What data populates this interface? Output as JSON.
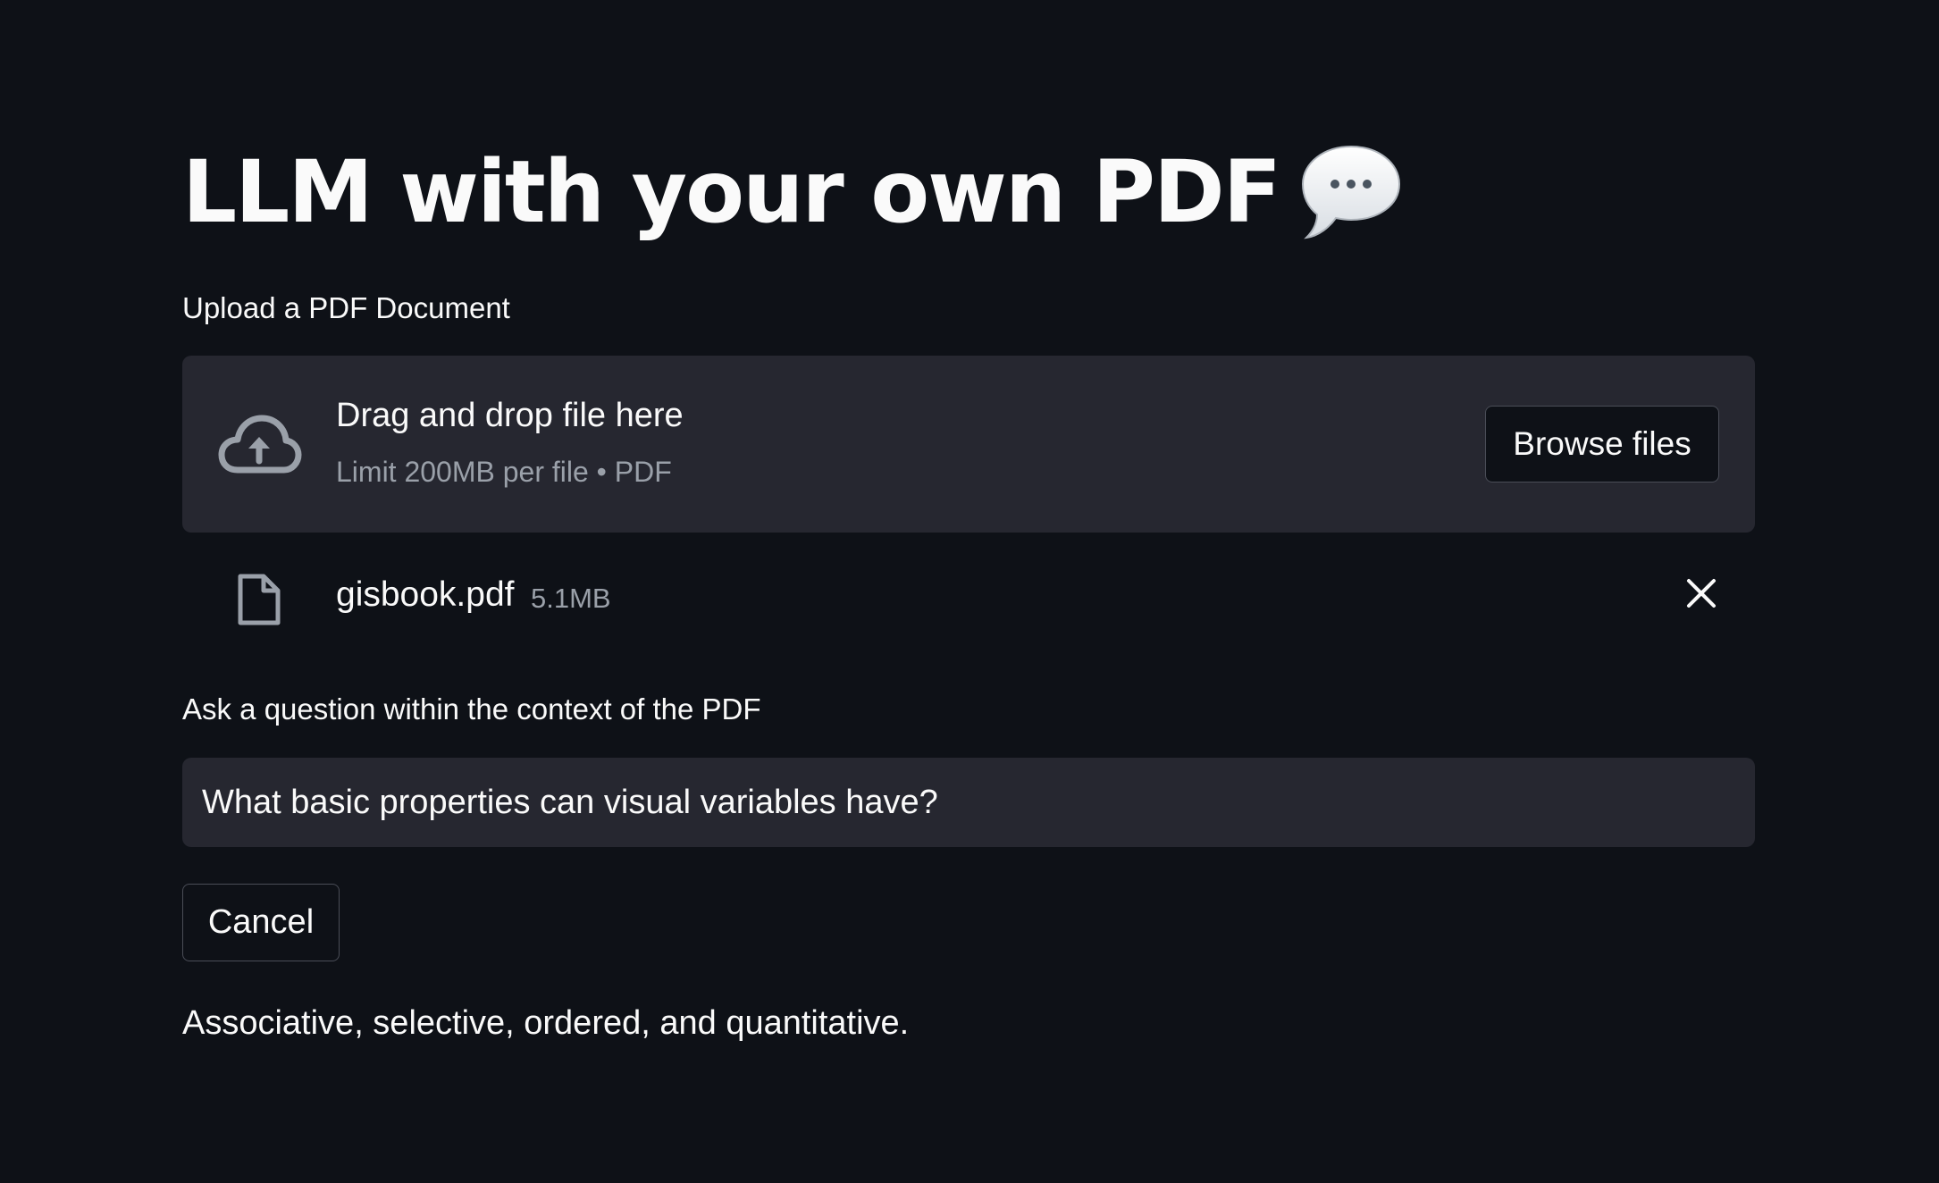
{
  "header": {
    "title": "LLM with your own PDF",
    "title_icon": "speech-balloon-icon"
  },
  "uploader": {
    "label": "Upload a PDF Document",
    "instructions": "Drag and drop file here",
    "limit": "Limit 200MB per file • PDF",
    "browse_label": "Browse files",
    "icon": "cloud-upload-icon"
  },
  "uploaded_file": {
    "name": "gisbook.pdf",
    "size": "5.1MB",
    "icon": "file-icon",
    "remove_icon": "close-icon"
  },
  "question": {
    "label": "Ask a question within the context of the PDF",
    "value": "What basic properties can visual variables have?"
  },
  "cancel_label": "Cancel",
  "answer": "Associative, selective, ordered, and quantitative.",
  "colors": {
    "background": "#0e1117",
    "panel": "#262730",
    "text": "#fafafa",
    "muted_text": "#9aa0a9",
    "border": "#4a4d57"
  }
}
